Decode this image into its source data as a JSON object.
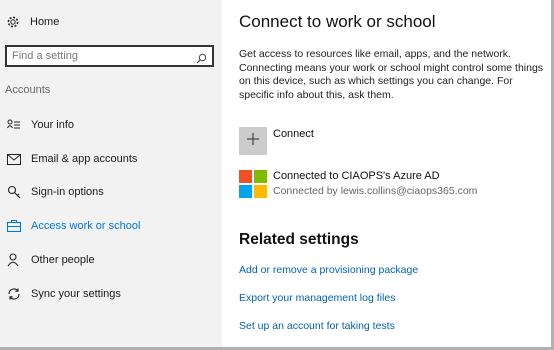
{
  "sidebar": {
    "home_label": "Home",
    "search_placeholder": "Find a setting",
    "section_title": "Accounts",
    "items": [
      {
        "label": "Your info",
        "icon": "person-card-icon"
      },
      {
        "label": "Email & app accounts",
        "icon": "mail-icon"
      },
      {
        "label": "Sign-in options",
        "icon": "key-icon"
      },
      {
        "label": "Access work or school",
        "icon": "briefcase-icon",
        "active": true
      },
      {
        "label": "Other people",
        "icon": "person-icon"
      },
      {
        "label": "Sync your settings",
        "icon": "sync-icon"
      }
    ]
  },
  "main": {
    "title": "Connect to work or school",
    "description": "Get access to resources like email, apps, and the network. Connecting means your work or school might control some things on this device, such as which settings you can change. For specific info about this, ask them.",
    "connect_label": "Connect",
    "org": {
      "title": "Connected to CIAOPS's Azure AD",
      "subtitle": "Connected by lewis.collins@ciaops365.com"
    },
    "related_title": "Related settings",
    "links": [
      "Add or remove a provisioning package",
      "Export your management log files",
      "Set up an account for taking tests"
    ]
  },
  "colors": {
    "accent": "#0078d7",
    "link": "#0063b1",
    "sidebar_bg": "#f2f2f2",
    "ms_red": "#f25022",
    "ms_green": "#7fba00",
    "ms_blue": "#00a4ef",
    "ms_yellow": "#ffb900"
  }
}
